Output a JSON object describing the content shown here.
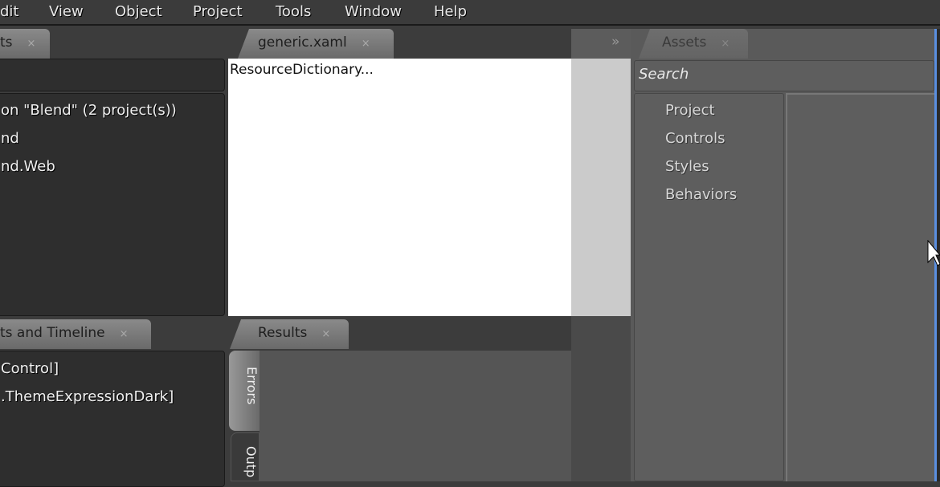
{
  "menu": [
    "dit",
    "View",
    "Object",
    "Project",
    "Tools",
    "Window",
    "Help"
  ],
  "left_top": {
    "tab": "ts",
    "tree": [
      "on \"Blend\" (2 project(s))",
      "nd",
      "nd.Web"
    ]
  },
  "doc": {
    "tab": "generic.xaml",
    "content": "ResourceDictionary..."
  },
  "right": {
    "expand": "»",
    "tab": "Assets",
    "search_placeholder": "Search",
    "categories": [
      "Project",
      "Controls",
      "Styles",
      "Behaviors"
    ]
  },
  "left_bottom": {
    "tab": "ts and Timeline",
    "items": [
      "Control]",
      ".ThemeExpressionDark]"
    ]
  },
  "results": {
    "tab": "Results",
    "vtabs": [
      "Errors",
      "Outp"
    ]
  },
  "close": "×",
  "colors": {
    "accent": "#5a8fe0"
  }
}
